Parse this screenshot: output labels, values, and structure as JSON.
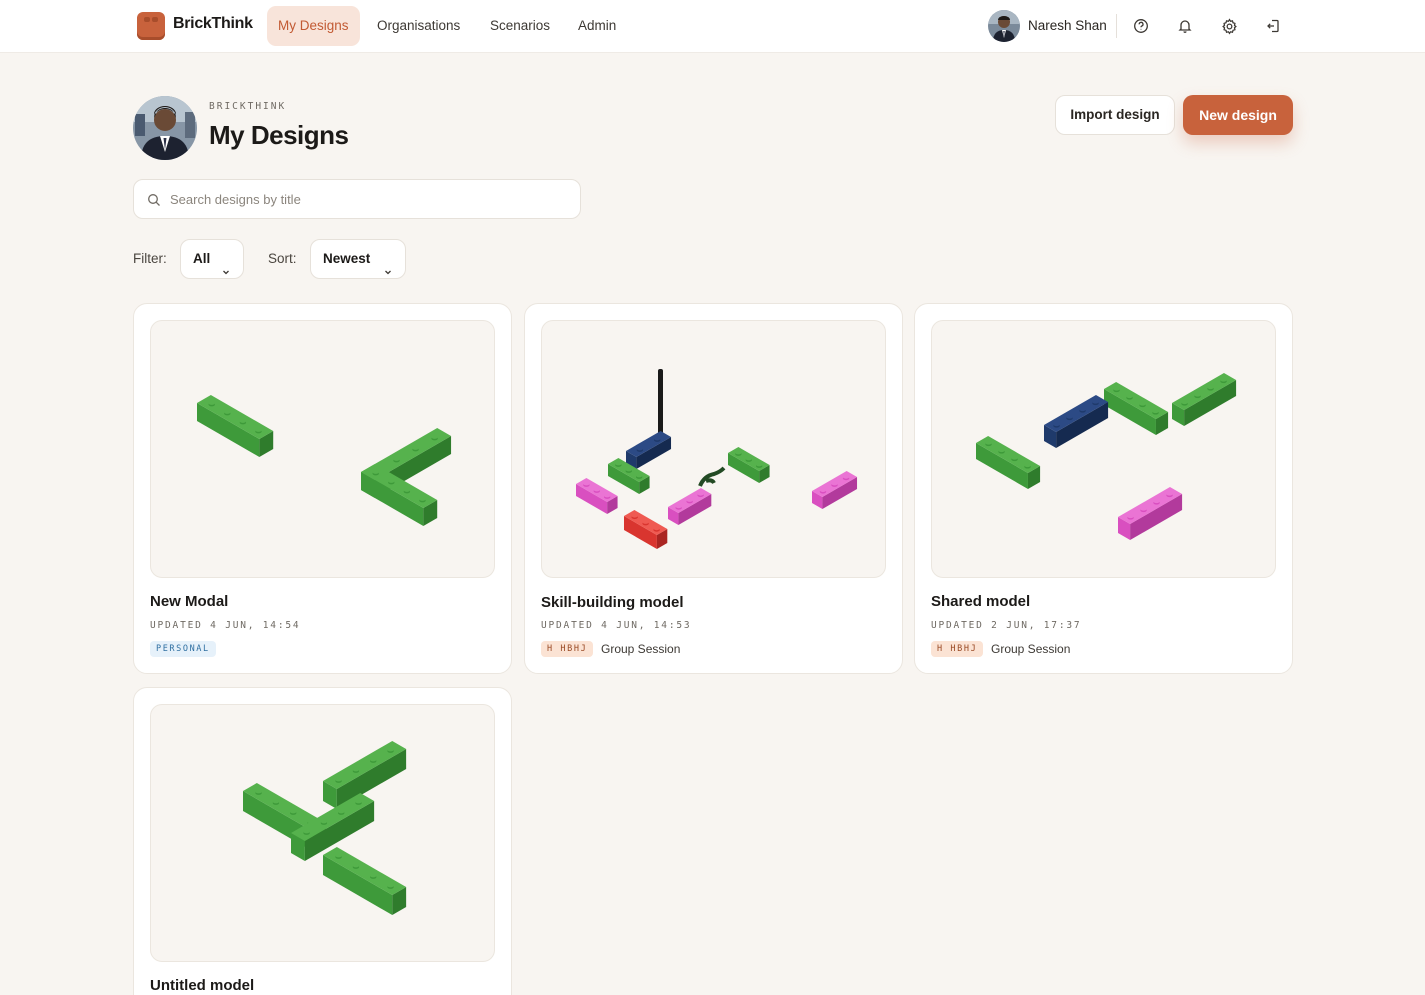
{
  "brand": {
    "name": "BrickThink",
    "color": "#c8623c"
  },
  "nav": {
    "items": [
      {
        "label": "My Designs",
        "active": true
      },
      {
        "label": "Organisations",
        "active": false
      },
      {
        "label": "Scenarios",
        "active": false
      },
      {
        "label": "Admin",
        "active": false
      }
    ]
  },
  "user": {
    "name": "Naresh Shan"
  },
  "header_icons": [
    "help-circle-icon",
    "bell-icon",
    "gear-icon",
    "logout-icon"
  ],
  "header": {
    "eyebrow": "BRICKTHINK",
    "title": "My Designs",
    "import_label": "Import design",
    "new_label": "New design"
  },
  "search": {
    "placeholder": "Search designs by title",
    "value": ""
  },
  "filters": {
    "filter_label": "Filter:",
    "filter_value": "All",
    "sort_label": "Sort:",
    "sort_value": "Newest"
  },
  "designs": [
    {
      "title": "New Modal",
      "updated": "UPDATED 4 JUN, 14:54",
      "badge": "PERSONAL",
      "badge_type": "personal",
      "session": ""
    },
    {
      "title": "Skill-building model",
      "updated": "UPDATED 4 JUN, 14:53",
      "badge": "H HBHJ",
      "badge_type": "org",
      "session": "Group Session"
    },
    {
      "title": "Shared model",
      "updated": "UPDATED 2 JUN, 17:37",
      "badge": "H HBHJ",
      "badge_type": "org",
      "session": "Group Session"
    },
    {
      "title": "Untitled model",
      "updated": "",
      "badge": "",
      "badge_type": "",
      "session": ""
    }
  ],
  "colors": {
    "accent": "#c8623c",
    "green_brick": "#3e9a3a",
    "navy_brick": "#1f3a6b",
    "magenta_brick": "#d94fc0",
    "red_brick": "#d9352f",
    "black_brick": "#1a1a1a"
  }
}
